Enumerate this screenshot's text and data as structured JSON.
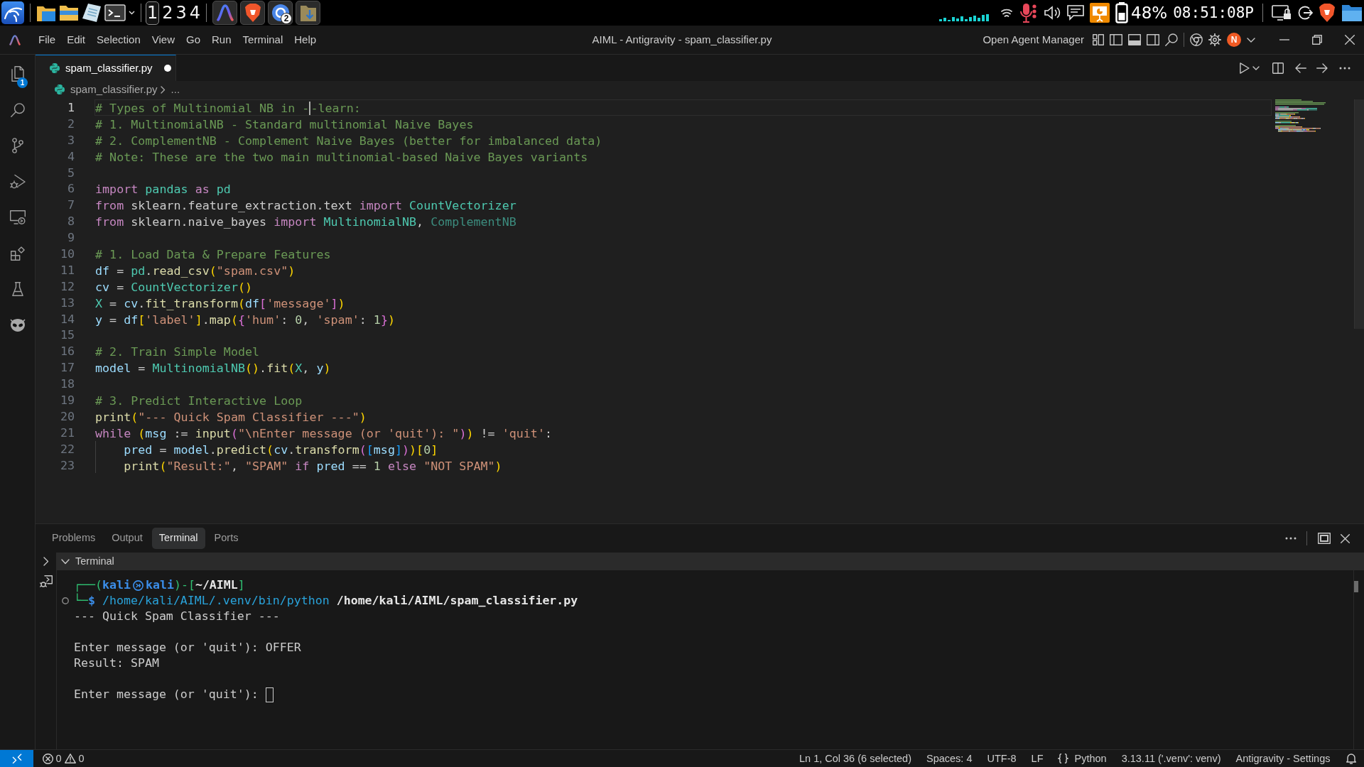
{
  "taskbar": {
    "workspaces": [
      {
        "label": "1",
        "selected": true
      },
      {
        "label": "2",
        "selected": false
      },
      {
        "label": "3",
        "selected": false
      },
      {
        "label": "4",
        "selected": false
      }
    ],
    "browser_badge": "2",
    "battery": "48%",
    "clock": "08:51:08P"
  },
  "window": {
    "menu": [
      "File",
      "Edit",
      "Selection",
      "View",
      "Go",
      "Run",
      "Terminal",
      "Help"
    ],
    "title": "AIML - Antigravity - spam_classifier.py",
    "agent_button": "Open Agent Manager",
    "avatar": "N"
  },
  "activity_bar": {
    "explorer_badge": "1"
  },
  "editor": {
    "tabs": [
      {
        "label": "spam_classifier.py",
        "selected": true,
        "modified": true
      }
    ],
    "breadcrumb": {
      "file": "spam_classifier.py",
      "more": "..."
    },
    "lines": [
      {
        "number": "1",
        "active": true,
        "tokens": [
          {
            "kind": "comment",
            "text": "# Types of Multinomial NB in -"
          },
          {
            "kind": "caret"
          },
          {
            "kind": "comment",
            "text": "-learn:"
          }
        ]
      },
      {
        "number": "2",
        "active": false,
        "tokens": [
          {
            "kind": "comment",
            "text": "# 1. MultinomialNB - Standard multinomial Naive Bayes"
          }
        ]
      },
      {
        "number": "3",
        "active": false,
        "tokens": [
          {
            "kind": "comment",
            "text": "# 2. ComplementNB - Complement Naive Bayes (better for imbalanced data)"
          }
        ]
      },
      {
        "number": "4",
        "active": false,
        "tokens": [
          {
            "kind": "comment",
            "text": "# Note: These are the two main multinomial-based Naive Bayes variants"
          }
        ]
      },
      {
        "number": "5",
        "active": false
      },
      {
        "number": "6",
        "active": false,
        "tokens": [
          {
            "kind": "keyword",
            "text": "import"
          },
          {
            "kind": "type",
            "text": " pandas"
          },
          {
            "kind": "keyword",
            "text": " as"
          },
          {
            "kind": "type",
            "text": " pd"
          }
        ]
      },
      {
        "number": "7",
        "active": false,
        "tokens": [
          {
            "kind": "keyword",
            "text": "from"
          },
          {
            "kind": "plain",
            "text": " sklearn.feature_extraction.text "
          },
          {
            "kind": "keyword",
            "text": "import"
          },
          {
            "kind": "type",
            "text": " CountVectorizer"
          }
        ]
      },
      {
        "number": "8",
        "active": false,
        "tokens": [
          {
            "kind": "keyword",
            "text": "from"
          },
          {
            "kind": "plain",
            "text": " sklearn.naive_bayes "
          },
          {
            "kind": "keyword",
            "text": "import"
          },
          {
            "kind": "type",
            "text": " MultinomialNB"
          },
          {
            "kind": "plain",
            "text": ", "
          },
          {
            "kind": "unused",
            "text": "ComplementNB"
          }
        ]
      },
      {
        "number": "9",
        "active": false
      },
      {
        "number": "10",
        "active": false,
        "tokens": [
          {
            "kind": "comment",
            "text": "# 1. Load Data & Prepare Features"
          }
        ]
      },
      {
        "number": "11",
        "active": false,
        "tokens": [
          {
            "kind": "variable",
            "text": "df"
          },
          {
            "kind": "plain",
            "text": " = "
          },
          {
            "kind": "type",
            "text": "pd"
          },
          {
            "kind": "plain",
            "text": "."
          },
          {
            "kind": "function",
            "text": "read_csv"
          },
          {
            "kind": "bracket1",
            "text": "("
          },
          {
            "kind": "string",
            "text": "\"spam.csv\""
          },
          {
            "kind": "bracket1",
            "text": ")"
          }
        ]
      },
      {
        "number": "12",
        "active": false,
        "tokens": [
          {
            "kind": "variable",
            "text": "cv"
          },
          {
            "kind": "plain",
            "text": " = "
          },
          {
            "kind": "type",
            "text": "CountVectorizer"
          },
          {
            "kind": "bracket1",
            "text": "()"
          }
        ]
      },
      {
        "number": "13",
        "active": false,
        "tokens": [
          {
            "kind": "type",
            "text": "X"
          },
          {
            "kind": "plain",
            "text": " = "
          },
          {
            "kind": "variable",
            "text": "cv"
          },
          {
            "kind": "plain",
            "text": "."
          },
          {
            "kind": "function",
            "text": "fit_transform"
          },
          {
            "kind": "bracket1",
            "text": "("
          },
          {
            "kind": "variable",
            "text": "df"
          },
          {
            "kind": "bracket2",
            "text": "["
          },
          {
            "kind": "string",
            "text": "'message'"
          },
          {
            "kind": "bracket2",
            "text": "]"
          },
          {
            "kind": "bracket1",
            "text": ")"
          }
        ]
      },
      {
        "number": "14",
        "active": false,
        "tokens": [
          {
            "kind": "variable",
            "text": "y"
          },
          {
            "kind": "plain",
            "text": " = "
          },
          {
            "kind": "variable",
            "text": "df"
          },
          {
            "kind": "bracket1",
            "text": "["
          },
          {
            "kind": "string",
            "text": "'label'"
          },
          {
            "kind": "bracket1",
            "text": "]"
          },
          {
            "kind": "plain",
            "text": "."
          },
          {
            "kind": "function",
            "text": "map"
          },
          {
            "kind": "bracket1",
            "text": "("
          },
          {
            "kind": "bracket2",
            "text": "{"
          },
          {
            "kind": "string",
            "text": "'hum'"
          },
          {
            "kind": "plain",
            "text": ": "
          },
          {
            "kind": "number",
            "text": "0"
          },
          {
            "kind": "plain",
            "text": ", "
          },
          {
            "kind": "string",
            "text": "'spam'"
          },
          {
            "kind": "plain",
            "text": ": "
          },
          {
            "kind": "number",
            "text": "1"
          },
          {
            "kind": "bracket2",
            "text": "}"
          },
          {
            "kind": "bracket1",
            "text": ")"
          }
        ]
      },
      {
        "number": "15",
        "active": false
      },
      {
        "number": "16",
        "active": false,
        "tokens": [
          {
            "kind": "comment",
            "text": "# 2. Train Simple Model"
          }
        ]
      },
      {
        "number": "17",
        "active": false,
        "tokens": [
          {
            "kind": "variable",
            "text": "model"
          },
          {
            "kind": "plain",
            "text": " = "
          },
          {
            "kind": "type",
            "text": "MultinomialNB"
          },
          {
            "kind": "bracket1",
            "text": "()"
          },
          {
            "kind": "plain",
            "text": "."
          },
          {
            "kind": "function",
            "text": "fit"
          },
          {
            "kind": "bracket1",
            "text": "("
          },
          {
            "kind": "type",
            "text": "X"
          },
          {
            "kind": "plain",
            "text": ", "
          },
          {
            "kind": "variable",
            "text": "y"
          },
          {
            "kind": "bracket1",
            "text": ")"
          }
        ]
      },
      {
        "number": "18",
        "active": false
      },
      {
        "number": "19",
        "active": false,
        "tokens": [
          {
            "kind": "comment",
            "text": "# 3. Predict Interactive Loop"
          }
        ]
      },
      {
        "number": "20",
        "active": false,
        "tokens": [
          {
            "kind": "function",
            "text": "print"
          },
          {
            "kind": "bracket1",
            "text": "("
          },
          {
            "kind": "string",
            "text": "\"--- Quick Spam Classifier ---\""
          },
          {
            "kind": "bracket1",
            "text": ")"
          }
        ]
      },
      {
        "number": "21",
        "active": false,
        "tokens": [
          {
            "kind": "keyword",
            "text": "while"
          },
          {
            "kind": "bracket1",
            "text": " ("
          },
          {
            "kind": "variable",
            "text": "msg"
          },
          {
            "kind": "plain",
            "text": " := "
          },
          {
            "kind": "function",
            "text": "input"
          },
          {
            "kind": "bracket2",
            "text": "("
          },
          {
            "kind": "string",
            "text": "\"\\nEnter message (or 'quit'): \""
          },
          {
            "kind": "bracket2",
            "text": ")"
          },
          {
            "kind": "bracket1",
            "text": ")"
          },
          {
            "kind": "plain",
            "text": " != "
          },
          {
            "kind": "string",
            "text": "'quit'"
          },
          {
            "kind": "plain",
            "text": ":"
          }
        ],
        "children": [
          {
            "number": "22",
            "active": false,
            "tokens": [
              {
                "kind": "variable",
                "text": "pred"
              },
              {
                "kind": "plain",
                "text": " = "
              },
              {
                "kind": "variable",
                "text": "model"
              },
              {
                "kind": "plain",
                "text": "."
              },
              {
                "kind": "function",
                "text": "predict"
              },
              {
                "kind": "bracket1",
                "text": "("
              },
              {
                "kind": "variable",
                "text": "cv"
              },
              {
                "kind": "plain",
                "text": "."
              },
              {
                "kind": "function",
                "text": "transform"
              },
              {
                "kind": "bracket2",
                "text": "("
              },
              {
                "kind": "bracket3",
                "text": "["
              },
              {
                "kind": "variable",
                "text": "msg"
              },
              {
                "kind": "bracket3",
                "text": "]"
              },
              {
                "kind": "bracket2",
                "text": ")"
              },
              {
                "kind": "bracket1",
                "text": ")"
              },
              {
                "kind": "bracket1",
                "text": "["
              },
              {
                "kind": "number",
                "text": "0"
              },
              {
                "kind": "bracket1",
                "text": "]"
              }
            ]
          },
          {
            "number": "23",
            "active": false,
            "tokens": [
              {
                "kind": "function",
                "text": "print"
              },
              {
                "kind": "bracket1",
                "text": "("
              },
              {
                "kind": "string",
                "text": "\"Result:\""
              },
              {
                "kind": "plain",
                "text": ", "
              },
              {
                "kind": "string",
                "text": "\"SPAM\""
              },
              {
                "kind": "keyword",
                "text": " if"
              },
              {
                "kind": "variable",
                "text": " pred"
              },
              {
                "kind": "plain",
                "text": " == "
              },
              {
                "kind": "number",
                "text": "1"
              },
              {
                "kind": "keyword",
                "text": " else"
              },
              {
                "kind": "string",
                "text": " \"NOT SPAM\""
              },
              {
                "kind": "bracket1",
                "text": ")"
              }
            ]
          }
        ]
      }
    ]
  },
  "panel": {
    "tabs": [
      {
        "label": "Problems",
        "selected": false
      },
      {
        "label": "Output",
        "selected": false
      },
      {
        "label": "Terminal",
        "selected": true
      },
      {
        "label": "Ports",
        "selected": false
      }
    ],
    "section": {
      "label": "Terminal",
      "expanded": true
    },
    "terminal": [
      {
        "kind": "prompt",
        "tokens": [
          {
            "kind": "frame",
            "text": "┌──("
          },
          {
            "kind": "user",
            "text": "kali"
          },
          {
            "kind": "symbol"
          },
          {
            "kind": "user",
            "text": "kali"
          },
          {
            "kind": "frame",
            "text": ")-["
          },
          {
            "kind": "path",
            "text": "~/AIML"
          },
          {
            "kind": "frame",
            "text": "]"
          }
        ]
      },
      {
        "kind": "command",
        "tokens": [
          {
            "kind": "frame",
            "text": "└─"
          },
          {
            "kind": "user",
            "text": "$"
          },
          {
            "kind": "command",
            "text": " /home/kali/AIML/.venv/bin/python"
          },
          {
            "kind": "path",
            "text": " /home/kali/AIML/spam_classifier.py"
          }
        ]
      },
      {
        "kind": "output",
        "text": "--- Quick Spam Classifier ---"
      },
      {
        "kind": "blank"
      },
      {
        "kind": "output",
        "text": "Enter message (or 'quit'): OFFER"
      },
      {
        "kind": "output",
        "text": "Result: SPAM"
      },
      {
        "kind": "blank"
      },
      {
        "kind": "input",
        "text": "Enter message (or 'quit'): "
      }
    ]
  },
  "status_bar": {
    "errors": "0",
    "warnings": "0",
    "items": [
      {
        "kind": "plain",
        "text": "Ln 1, Col 36 (6 selected)"
      },
      {
        "kind": "plain",
        "text": "Spaces: 4"
      },
      {
        "kind": "plain",
        "text": "UTF-8"
      },
      {
        "kind": "plain",
        "text": "LF"
      },
      {
        "kind": "language",
        "text": "Python"
      },
      {
        "kind": "plain",
        "text": "3.13.11 ('.venv': venv)"
      },
      {
        "kind": "plain",
        "text": "Antigravity - Settings"
      }
    ]
  }
}
